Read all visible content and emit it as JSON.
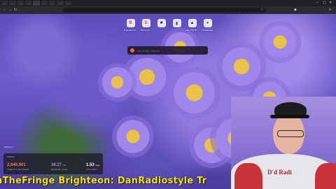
{
  "browser": {
    "tabs": [
      {
        "label": "..."
      },
      {
        "label": "..."
      },
      {
        "label": "..."
      },
      {
        "label": "..."
      },
      {
        "label": "..."
      },
      {
        "label": "..."
      },
      {
        "label": "..."
      },
      {
        "label": "..."
      },
      {
        "label": "..."
      }
    ],
    "url": ""
  },
  "shortcuts": [
    {
      "label": "Brighteon St...",
      "glyph": "B",
      "color": "#e0453a"
    },
    {
      "label": "Brave Asl...",
      "glyph": "B",
      "color": "#f06a2b"
    },
    {
      "label": "",
      "glyph": "■",
      "color": "#2b2b2b"
    },
    {
      "label": "",
      "glyph": "▮",
      "color": "#1f6fd1"
    },
    {
      "label": "Use The Bl...",
      "glyph": "▲",
      "color": "#222"
    },
    {
      "label": "Knowledge",
      "glyph": "●",
      "color": "#555"
    }
  ],
  "search": {
    "placeholder": "Ask Brave Search"
  },
  "photo_credit": "Photo by ...",
  "stats": {
    "title": "STATS",
    "items": [
      {
        "value": "2,640,901",
        "unit": "",
        "label": "Trackers & ads blocked",
        "color": "#f27f47"
      },
      {
        "value": "38.27",
        "unit": "GB",
        "label": "Bandwidth saved",
        "color": "#b57af0"
      },
      {
        "value": "1.53",
        "unit": "days",
        "label": "Time saved",
        "color": "#ffffff"
      }
    ]
  },
  "webcam": {
    "shirt_text": "D'd Radi"
  },
  "ticker": {
    "text": "nTheFringe Brighteon: DanRadiostyle Tr"
  }
}
